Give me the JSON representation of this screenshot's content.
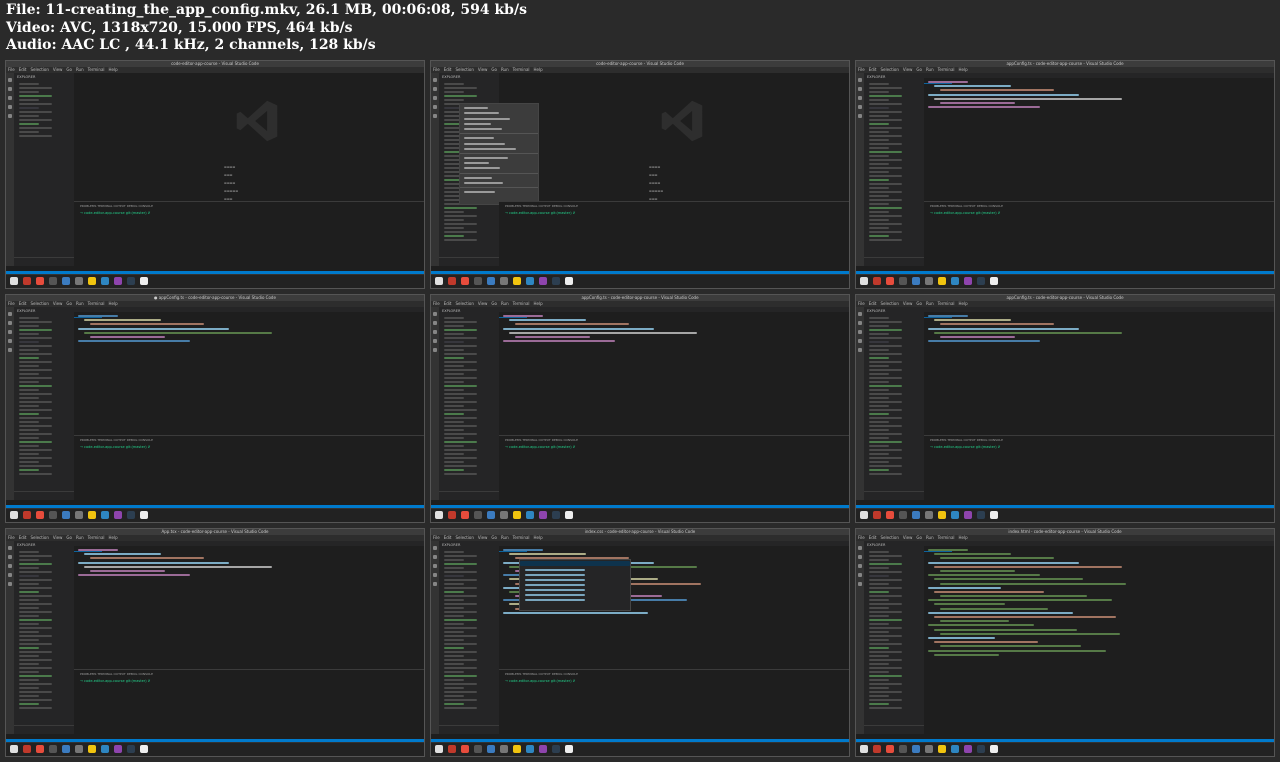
{
  "header": {
    "file_line": "File: 11-creating_the_app_config.mkv, 26.1 MB, 00:06:08, 594 kb/s",
    "video_line": "Video: AVC, 1318x720, 15.000 FPS, 464 kb/s",
    "audio_line": "Audio: AAC LC , 44.1 kHz, 2 channels, 128 kb/s"
  },
  "frames": [
    {
      "title": "code-editor-app-course - Visual Studio Code",
      "view": "welcome"
    },
    {
      "title": "code-editor-app-course - Visual Studio Code",
      "view": "context-menu"
    },
    {
      "title": "appConfig.ts - code-editor-app-course - Visual Studio Code",
      "view": "error"
    },
    {
      "title": "● appConfig.ts - code-editor-app-course - Visual Studio Code",
      "view": "code"
    },
    {
      "title": "appConfig.ts - code-editor-app-course - Visual Studio Code",
      "view": "code"
    },
    {
      "title": "appConfig.ts - code-editor-app-course - Visual Studio Code",
      "view": "code"
    },
    {
      "title": "App.tsx - code-editor-app-course - Visual Studio Code",
      "view": "code"
    },
    {
      "title": "index.css - code-editor-app-course - Visual Studio Code",
      "view": "suggest"
    },
    {
      "title": "index.html - code-editor-app-course - Visual Studio Code",
      "view": "comments"
    }
  ],
  "menu_items": [
    "File",
    "Edit",
    "Selection",
    "View",
    "Go",
    "Run",
    "Terminal",
    "Help"
  ],
  "terminal_prompt": "→ code-editor-app-course git:(master) ✗",
  "panel_tabs": "PROBLEMS   TERMINAL   OUTPUT   DEBUG CONSOLE",
  "explorer_label": "EXPLORER",
  "outline_label": "OUTLINE",
  "colors": {
    "background": "#2a2a2a",
    "editor": "#1e1e1e",
    "sidebar": "#252526",
    "status": "#007acc",
    "accent_keyword": "#c586c0",
    "accent_string": "#ce9178",
    "accent_var": "#9cdcfe"
  }
}
